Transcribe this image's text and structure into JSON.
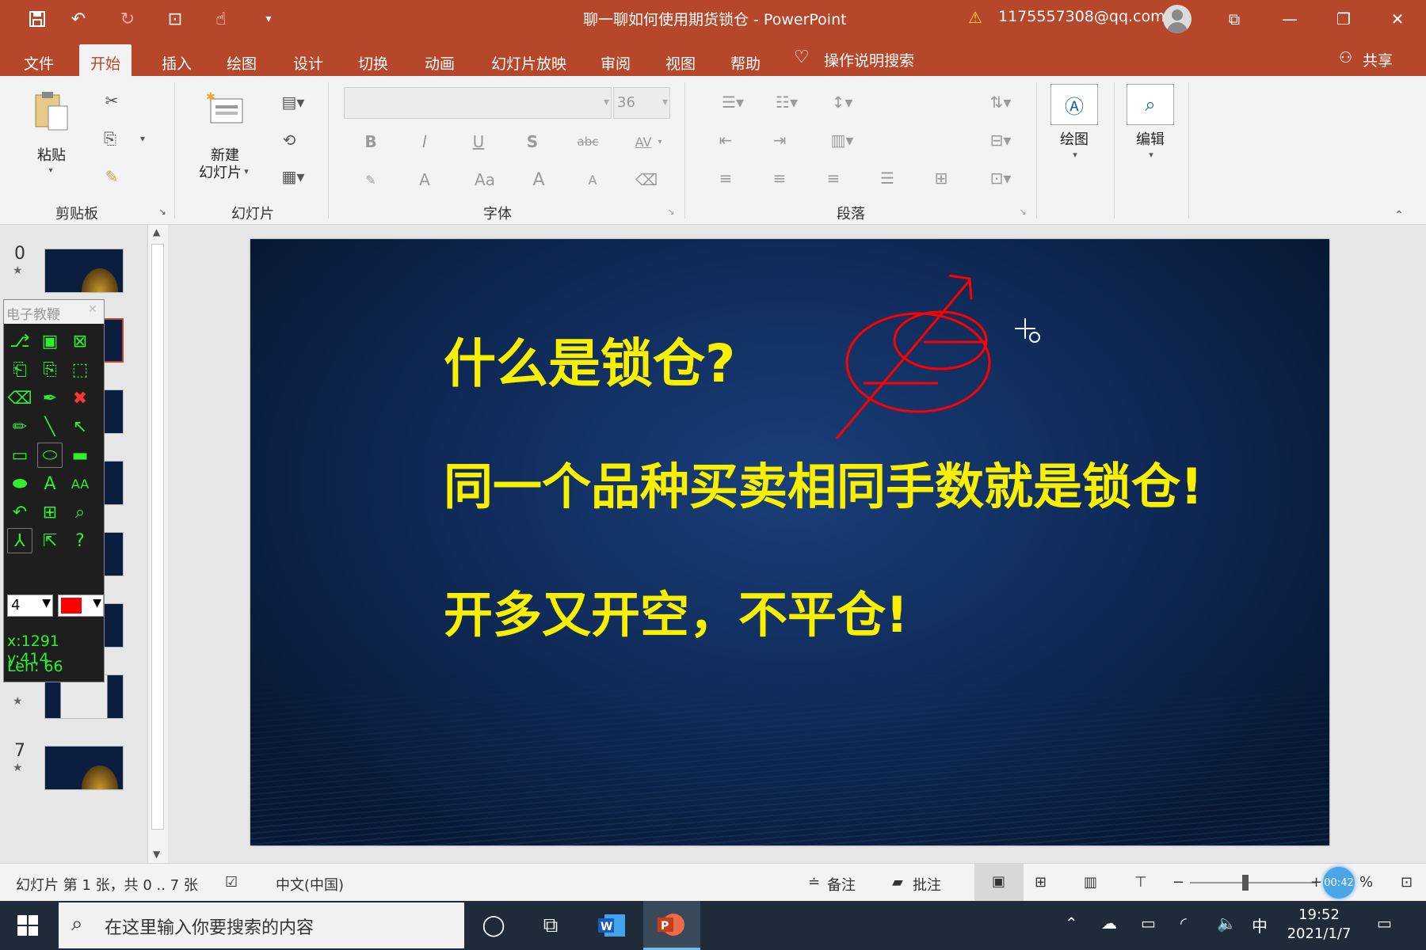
{
  "titlebar": {
    "doc_title": "聊一聊如何使用期货锁仓 - PowerPoint",
    "user_email": "1175557308@qq.com",
    "quick_access": [
      "save-icon",
      "undo-icon",
      "redo-icon",
      "present-icon",
      "touch-mode-icon",
      "customize-icon"
    ]
  },
  "tabs": [
    "文件",
    "开始",
    "插入",
    "绘图",
    "设计",
    "切换",
    "动画",
    "幻灯片放映",
    "审阅",
    "视图",
    "帮助"
  ],
  "active_tab": "开始",
  "tellme": "操作说明搜索",
  "share": "共享",
  "ribbon": {
    "clipboard": {
      "paste": "粘贴",
      "group": "剪贴板"
    },
    "slides": {
      "new_slide_1": "新建",
      "new_slide_2": "幻灯片",
      "group": "幻灯片"
    },
    "font": {
      "size": "36",
      "group": "字体",
      "buttons": [
        "B",
        "I",
        "U",
        "S",
        "abc",
        "AV",
        "A",
        "Aa",
        "A",
        "A"
      ]
    },
    "paragraph": {
      "group": "段落"
    },
    "drawing": {
      "label": "绘图"
    },
    "editing": {
      "label": "编辑"
    }
  },
  "thumbnails": {
    "first_number": "0",
    "last_number": "7"
  },
  "slide": {
    "line1": "什么是锁仓?",
    "line2": "同一个品种买卖相同手数就是锁仓!",
    "line3": "开多又开空，不平仓!",
    "text_color": "#f8f000",
    "ink_color": "#ff0000"
  },
  "pen_tool": {
    "title": "电子教鞭",
    "size": "4",
    "color": "#ff0000",
    "coord": "x:1291 y:414",
    "len": "Len: 66"
  },
  "statusbar": {
    "slide_info": "幻灯片 第 1 张，共 0 .. 7 张",
    "language": "中文(中国)",
    "notes": "备注",
    "comments": "批注",
    "zoom_time": "00:42",
    "percent": "%"
  },
  "taskbar": {
    "search_placeholder": "在这里输入你要搜索的内容",
    "ime": "中",
    "time": "19:52",
    "date": "2021/1/7"
  },
  "colors": {
    "accent": "#b7472a",
    "pen_green": "#2ef02e"
  }
}
